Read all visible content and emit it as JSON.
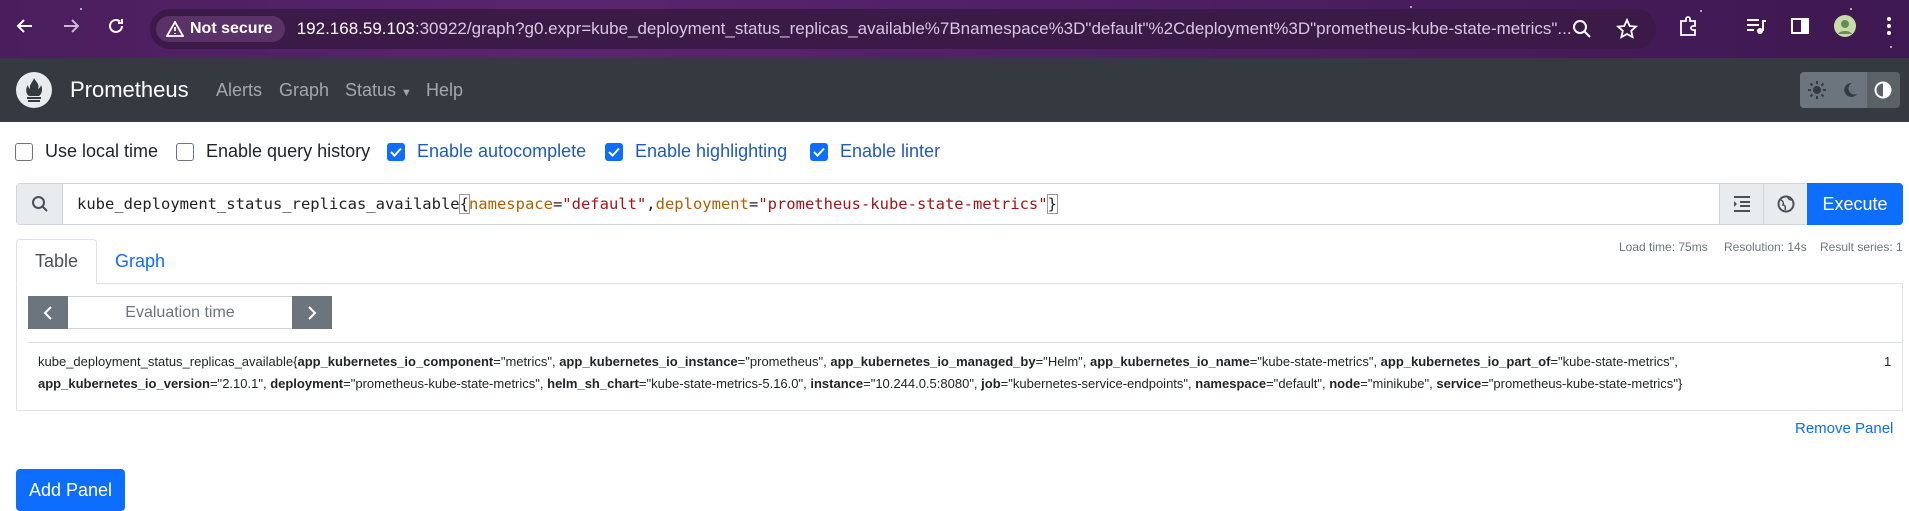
{
  "browser": {
    "security_label": "Not secure",
    "url_host": "192.168.59.103",
    "url_rest": ":30922/graph?g0.expr=kube_deployment_status_replicas_available%7Bnamespace%3D\"default\"%2Cdeployment%3D\"prometheus-kube-state-metrics\"..."
  },
  "navbar": {
    "brand": "Prometheus",
    "links": [
      "Alerts",
      "Graph",
      "Status",
      "Help"
    ]
  },
  "options": [
    {
      "label": "Use local time",
      "checked": false
    },
    {
      "label": "Enable query history",
      "checked": false
    },
    {
      "label": "Enable autocomplete",
      "checked": true
    },
    {
      "label": "Enable highlighting",
      "checked": true
    },
    {
      "label": "Enable linter",
      "checked": true
    }
  ],
  "query": {
    "metric": "kube_deployment_status_replicas_available",
    "open_brace": "{",
    "label1": "namespace",
    "eq1": "=",
    "value1": "\"default\"",
    "comma": ",",
    "label2": "deployment",
    "eq2": "=",
    "value2": "\"prometheus-kube-state-metrics\"",
    "close_brace": "}",
    "execute_label": "Execute"
  },
  "tabs": [
    "Table",
    "Graph"
  ],
  "stats": {
    "load_time": "Load time: 75ms",
    "resolution": "Resolution: 14s",
    "result_series": "Result series: 1"
  },
  "evaluation": {
    "placeholder": "Evaluation time"
  },
  "result": {
    "metric": "kube_deployment_status_replicas_available",
    "labels": [
      {
        "k": "app_kubernetes_io_component",
        "v": "metrics"
      },
      {
        "k": "app_kubernetes_io_instance",
        "v": "prometheus"
      },
      {
        "k": "app_kubernetes_io_managed_by",
        "v": "Helm"
      },
      {
        "k": "app_kubernetes_io_name",
        "v": "kube-state-metrics"
      },
      {
        "k": "app_kubernetes_io_part_of",
        "v": "kube-state-metrics"
      },
      {
        "k": "app_kubernetes_io_version",
        "v": "2.10.1"
      },
      {
        "k": "deployment",
        "v": "prometheus-kube-state-metrics"
      },
      {
        "k": "helm_sh_chart",
        "v": "kube-state-metrics-5.16.0"
      },
      {
        "k": "instance",
        "v": "10.244.0.5:8080"
      },
      {
        "k": "job",
        "v": "kubernetes-service-endpoints"
      },
      {
        "k": "namespace",
        "v": "default"
      },
      {
        "k": "node",
        "v": "minikube"
      },
      {
        "k": "service",
        "v": "prometheus-kube-state-metrics"
      }
    ],
    "value": "1"
  },
  "panel": {
    "remove_label": "Remove Panel",
    "add_label": "Add Panel"
  }
}
